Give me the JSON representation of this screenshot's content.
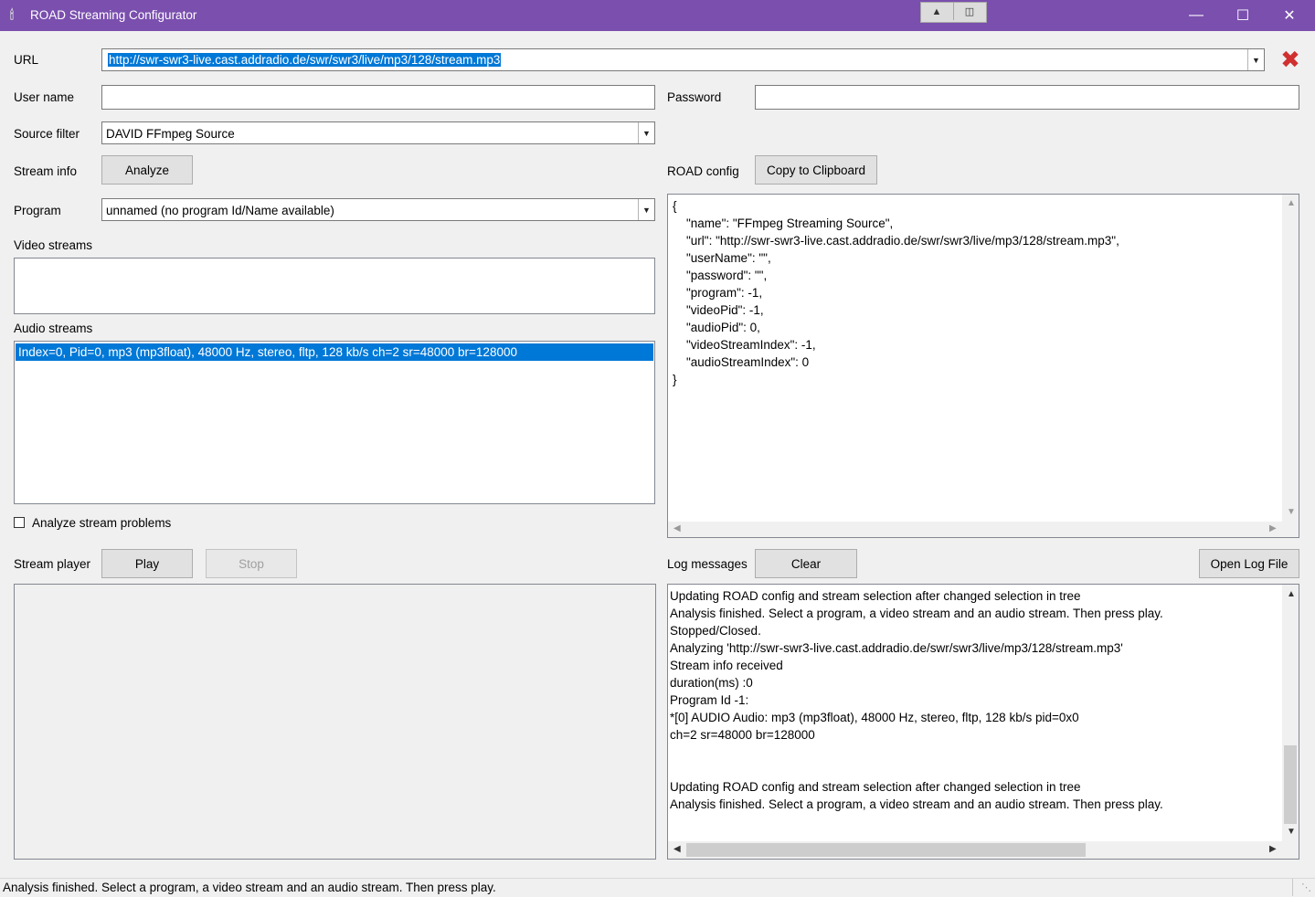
{
  "window": {
    "title": "ROAD Streaming Configurator"
  },
  "url": {
    "label": "URL",
    "value": "http://swr-swr3-live.cast.addradio.de/swr/swr3/live/mp3/128/stream.mp3"
  },
  "username": {
    "label": "User name",
    "value": ""
  },
  "password": {
    "label": "Password",
    "value": ""
  },
  "source_filter": {
    "label": "Source filter",
    "selected": "DAVID FFmpeg Source"
  },
  "stream_info": {
    "label": "Stream info",
    "analyze_label": "Analyze"
  },
  "road_config": {
    "label": "ROAD config",
    "copy_label": "Copy to Clipboard",
    "lines": [
      "{",
      "    \"name\": \"FFmpeg Streaming Source\",",
      "    \"url\": \"http://swr-swr3-live.cast.addradio.de/swr/swr3/live/mp3/128/stream.mp3\",",
      "    \"userName\": \"\",",
      "    \"password\": \"\",",
      "    \"program\": -1,",
      "    \"videoPid\": -1,",
      "    \"audioPid\": 0,",
      "    \"videoStreamIndex\": -1,",
      "    \"audioStreamIndex\": 0",
      "}"
    ]
  },
  "program": {
    "label": "Program",
    "selected": "unnamed (no program Id/Name available)"
  },
  "video_streams": {
    "label": "Video streams",
    "items": []
  },
  "audio_streams": {
    "label": "Audio streams",
    "items": [
      "Index=0, Pid=0, mp3 (mp3float), 48000 Hz, stereo, fltp, 128 kb/s ch=2 sr=48000 br=128000"
    ]
  },
  "analyze_problems": {
    "label": "Analyze stream problems",
    "checked": false
  },
  "stream_player": {
    "label": "Stream player",
    "play_label": "Play",
    "stop_label": "Stop"
  },
  "log": {
    "label": "Log messages",
    "clear_label": "Clear",
    "open_label": "Open Log File",
    "lines": [
      "Updating ROAD config and stream selection after changed selection in tree",
      "Analysis finished. Select a program, a video stream and an audio stream. Then press play.",
      "Stopped/Closed.",
      "Analyzing 'http://swr-swr3-live.cast.addradio.de/swr/swr3/live/mp3/128/stream.mp3'",
      "Stream info received",
      "duration(ms) :0",
      "Program Id -1:",
      "*[0] AUDIO Audio: mp3 (mp3float), 48000 Hz, stereo, fltp, 128 kb/s pid=0x0",
      "ch=2 sr=48000 br=128000",
      "",
      "",
      "Updating ROAD config and stream selection after changed selection in tree",
      "Analysis finished. Select a program, a video stream and an audio stream. Then press play."
    ]
  },
  "status": {
    "text": "Analysis finished. Select a program, a video stream and an audio stream. Then press play."
  },
  "colors": {
    "titlebar": "#7a4fae",
    "selection": "#0078d7",
    "close_x": "#d03030"
  }
}
